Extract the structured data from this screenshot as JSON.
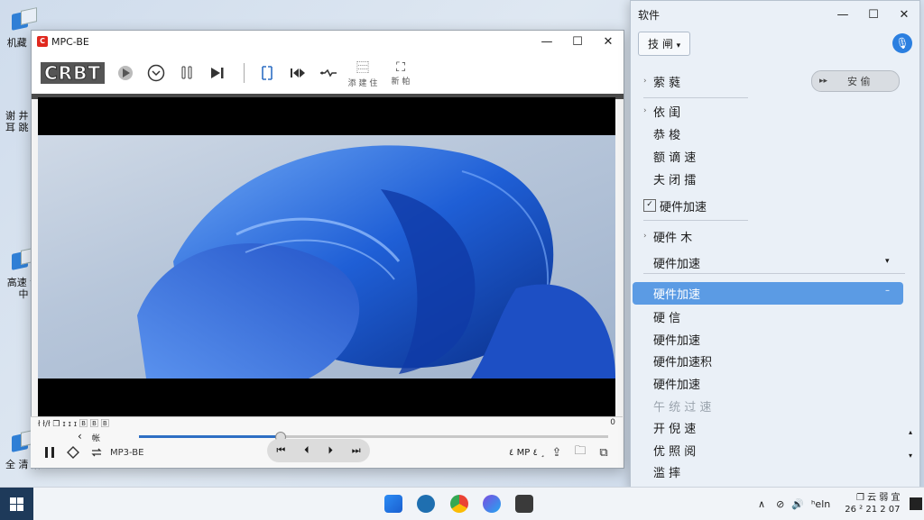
{
  "desktop": {
    "icons": [
      {
        "label": "机藏 宝"
      },
      {
        "label": "谢 井 弼 耳 跳 队"
      },
      {
        "label": "高速 设 中"
      },
      {
        "label": "全 清 解"
      }
    ]
  },
  "player": {
    "title": "MPC-BE",
    "logo_text": "C",
    "toolbar": {
      "brand": "CRBT",
      "btn_a_label": "添 建 住",
      "btn_b_label": "新 帕"
    },
    "controls": {
      "status_left": "ł ł/ł ❐ ɪ ɪ ɪ 🄱 🄱 🄱",
      "time_right": "0",
      "back_label": "‹",
      "chapter_label": "帐",
      "format_label": "MP3-BE",
      "audio_label": "٤ MP ٤ ¸",
      "progress": 0.3
    }
  },
  "settings": {
    "title": "软件",
    "dropdown_label": "技 闸",
    "pill_label": "安 偷",
    "items": [
      {
        "label": "萦 蕤",
        "chevron": true
      },
      {
        "label": "依 闺",
        "chevron": true
      },
      {
        "label": "恭 梭"
      },
      {
        "label": "额 谪 速"
      },
      {
        "label": "夫 闭 擂"
      },
      {
        "label": "硬件加速",
        "checkbox": true
      },
      {
        "label": "硬件 木",
        "chevron": true
      },
      {
        "label": "硬件加速"
      },
      {
        "label": "硬件加速",
        "selected": true
      },
      {
        "label": "硬 信"
      },
      {
        "label": "硬件加速"
      },
      {
        "label": "硬件加速积"
      },
      {
        "label": "硬件加速"
      },
      {
        "label": "午 统 过 速",
        "gray": true
      },
      {
        "label": "开 倪 速"
      },
      {
        "label": "优 照 阅"
      },
      {
        "label": "滥 摔"
      }
    ]
  },
  "taskbar": {
    "tray_lang": "ʰeln",
    "clock_time": "❐ 云 弱 宜",
    "clock_date": "26 ² 21 2 07"
  },
  "colors": {
    "accent": "#2e6fc4",
    "selection": "#5b9be4",
    "flower": "#1f5fd6"
  }
}
